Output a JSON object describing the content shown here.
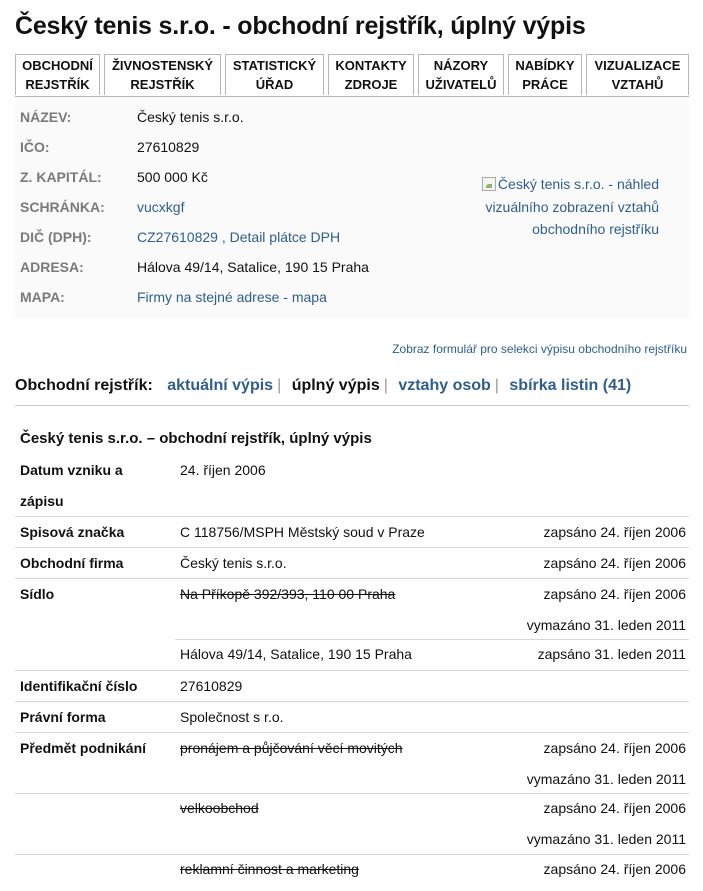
{
  "title": "Český tenis s.r.o. - obchodní rejstřík, úplný výpis",
  "tabs": [
    {
      "line1": "Obchodní",
      "line2": "rejstřík"
    },
    {
      "line1": "Živnostenský",
      "line2": "rejstřík"
    },
    {
      "line1": "Statistický",
      "line2": "úřad"
    },
    {
      "line1": "Kontakty",
      "line2": "zdroje"
    },
    {
      "line1": "Názory",
      "line2": "uživatelů"
    },
    {
      "line1": "Nabídky",
      "line2": "práce"
    },
    {
      "line1": "Vizualizace",
      "line2": "vztahů"
    }
  ],
  "info": {
    "nazev_label": "NÁZEV:",
    "nazev": "Český tenis s.r.o.",
    "ico_label": "IČO:",
    "ico": "27610829",
    "kapital_label": "Z. KAPITÁL:",
    "kapital": "500 000 Kč",
    "schranka_label": "SCHRÁNKA:",
    "schranka": "vucxkgf",
    "dic_label": "DIČ (DPH):",
    "dic": "CZ27610829",
    "dic_sep": " , ",
    "dph_detail": "Detail plátce DPH",
    "adresa_label": "ADRESA:",
    "adresa": "Hálova 49/14, Satalice, 190 15 Praha",
    "mapa_label": "MAPA:",
    "mapa": "Firmy na stejné adrese - mapa",
    "preview_alt": "Český tenis s.r.o. - náhled vizuálního zobrazení vztahů obchodního rejstříku"
  },
  "select_form_link": "Zobraz formulář pro selekci výpisu obchodního rejstříku",
  "registry_nav": {
    "label": "Obchodní rejstřík:",
    "aktualni": "aktuální výpis",
    "uplny": "úplný výpis",
    "vztahy": "vztahy osob",
    "sbirka": "sbírka listin (41)",
    "sep": "|"
  },
  "extract": {
    "title": "Český tenis s.r.o. – obchodní rejstřík, úplný výpis",
    "datum_label": "Datum vzniku a zápisu",
    "datum": "24. říjen 2006",
    "spis_label": "Spisová značka",
    "spis": "C 118756/MSPH Městský soud v Praze",
    "spis_date": "zapsáno 24. říjen 2006",
    "firma_label": "Obchodní firma",
    "firma": "Český tenis s.r.o.",
    "firma_date": "zapsáno 24. říjen 2006",
    "sidlo_label": "Sídlo",
    "sidlo_old": "Na Příkopě 392/393, 110 00 Praha",
    "sidlo_old_zapsano": "zapsáno 24. říjen 2006",
    "sidlo_old_vymazano": "vymazáno 31. leden 2011",
    "sidlo_new": "Hálova 49/14, Satalice, 190 15 Praha",
    "sidlo_new_zapsano": "zapsáno 31. leden 2011",
    "ic_label": "Identifikační číslo",
    "ic": "27610829",
    "forma_label": "Právní forma",
    "forma": "Společnost s r.o.",
    "predmet_label": "Předmět podnikání",
    "predmet1": "pronájem a půjčování věcí movitých",
    "predmet1_zapsano": "zapsáno 24. říjen 2006",
    "predmet1_vymazano": "vymazáno 31. leden 2011",
    "predmet2": "velkoobchod",
    "predmet2_zapsano": "zapsáno 24. říjen 2006",
    "predmet2_vymazano": "vymazáno 31. leden 2011",
    "predmet3": "reklamní činnost a marketing",
    "predmet3_zapsano": "zapsáno 24. říjen 2006"
  }
}
